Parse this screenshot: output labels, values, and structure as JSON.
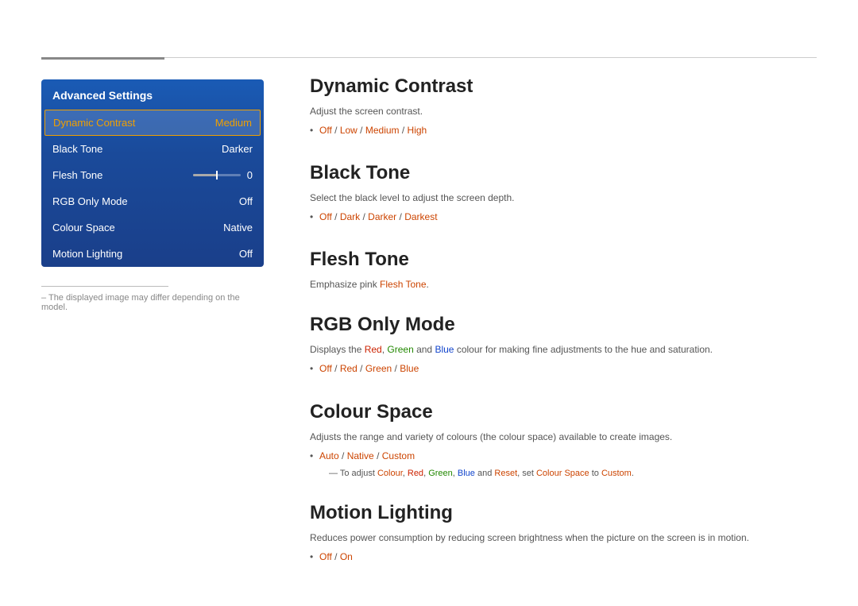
{
  "topDivider": {},
  "leftPanel": {
    "title": "Advanced Settings",
    "items": [
      {
        "id": "dynamic-contrast",
        "label": "Dynamic Contrast",
        "value": "Medium",
        "selected": true
      },
      {
        "id": "black-tone",
        "label": "Black Tone",
        "value": "Darker",
        "selected": false
      },
      {
        "id": "flesh-tone",
        "label": "Flesh Tone",
        "value": "0",
        "selected": false,
        "hasSlider": true
      },
      {
        "id": "rgb-only-mode",
        "label": "RGB Only Mode",
        "value": "Off",
        "selected": false
      },
      {
        "id": "colour-space",
        "label": "Colour Space",
        "value": "Native",
        "selected": false
      },
      {
        "id": "motion-lighting",
        "label": "Motion Lighting",
        "value": "Off",
        "selected": false
      }
    ]
  },
  "footnote": "– The displayed image may differ depending on the model.",
  "sections": [
    {
      "id": "dynamic-contrast",
      "title": "Dynamic Contrast",
      "desc": "Adjust the screen contrast.",
      "options": [
        {
          "text_parts": [
            {
              "text": "Off",
              "style": "orange"
            },
            {
              "text": " / ",
              "style": "normal"
            },
            {
              "text": "Low",
              "style": "orange"
            },
            {
              "text": " / ",
              "style": "normal"
            },
            {
              "text": "Medium",
              "style": "orange"
            },
            {
              "text": " / ",
              "style": "normal"
            },
            {
              "text": "High",
              "style": "orange"
            }
          ]
        }
      ]
    },
    {
      "id": "black-tone",
      "title": "Black Tone",
      "desc": "Select the black level to adjust the screen depth.",
      "options": [
        {
          "text_parts": [
            {
              "text": "Off",
              "style": "orange"
            },
            {
              "text": " / ",
              "style": "normal"
            },
            {
              "text": "Dark",
              "style": "orange"
            },
            {
              "text": " / ",
              "style": "normal"
            },
            {
              "text": "Darker",
              "style": "orange"
            },
            {
              "text": " / ",
              "style": "normal"
            },
            {
              "text": "Darkest",
              "style": "orange"
            }
          ]
        }
      ]
    },
    {
      "id": "flesh-tone",
      "title": "Flesh Tone",
      "desc": "Emphasize pink",
      "desc_highlight": "Flesh Tone",
      "desc_end": ".",
      "options": []
    },
    {
      "id": "rgb-only-mode",
      "title": "RGB Only Mode",
      "desc": "Displays the",
      "desc_parts": [
        {
          "text": "Displays the ",
          "style": "normal"
        },
        {
          "text": "Red",
          "style": "red"
        },
        {
          "text": ", ",
          "style": "normal"
        },
        {
          "text": "Green",
          "style": "green"
        },
        {
          "text": " and ",
          "style": "normal"
        },
        {
          "text": "Blue",
          "style": "blue"
        },
        {
          "text": " colour for making fine adjustments to the hue and saturation.",
          "style": "normal"
        }
      ],
      "options": [
        {
          "text_parts": [
            {
              "text": "Off",
              "style": "orange"
            },
            {
              "text": " / ",
              "style": "normal"
            },
            {
              "text": "Red",
              "style": "orange"
            },
            {
              "text": " / ",
              "style": "normal"
            },
            {
              "text": "Green",
              "style": "orange"
            },
            {
              "text": " / ",
              "style": "normal"
            },
            {
              "text": "Blue",
              "style": "orange"
            }
          ]
        }
      ]
    },
    {
      "id": "colour-space",
      "title": "Colour Space",
      "desc": "Adjusts the range and variety of colours (the colour space) available to create images.",
      "options": [
        {
          "text_parts": [
            {
              "text": "Auto",
              "style": "orange"
            },
            {
              "text": " / ",
              "style": "normal"
            },
            {
              "text": "Native",
              "style": "orange"
            },
            {
              "text": " / ",
              "style": "normal"
            },
            {
              "text": "Custom",
              "style": "orange"
            }
          ]
        }
      ],
      "subnote_parts": [
        {
          "text": "To adjust ",
          "style": "normal"
        },
        {
          "text": "Colour",
          "style": "orange"
        },
        {
          "text": ", ",
          "style": "normal"
        },
        {
          "text": "Red",
          "style": "red"
        },
        {
          "text": ", ",
          "style": "normal"
        },
        {
          "text": "Green",
          "style": "green"
        },
        {
          "text": ", ",
          "style": "normal"
        },
        {
          "text": "Blue",
          "style": "blue"
        },
        {
          "text": " and ",
          "style": "normal"
        },
        {
          "text": "Reset",
          "style": "orange"
        },
        {
          "text": ", set ",
          "style": "normal"
        },
        {
          "text": "Colour Space",
          "style": "orange"
        },
        {
          "text": " to ",
          "style": "normal"
        },
        {
          "text": "Custom",
          "style": "orange"
        },
        {
          "text": ".",
          "style": "normal"
        }
      ]
    },
    {
      "id": "motion-lighting",
      "title": "Motion Lighting",
      "desc": "Reduces power consumption by reducing screen brightness when the picture on the screen is in motion.",
      "options": [
        {
          "text_parts": [
            {
              "text": "Off",
              "style": "orange"
            },
            {
              "text": " / ",
              "style": "normal"
            },
            {
              "text": "On",
              "style": "orange"
            }
          ]
        }
      ]
    }
  ]
}
